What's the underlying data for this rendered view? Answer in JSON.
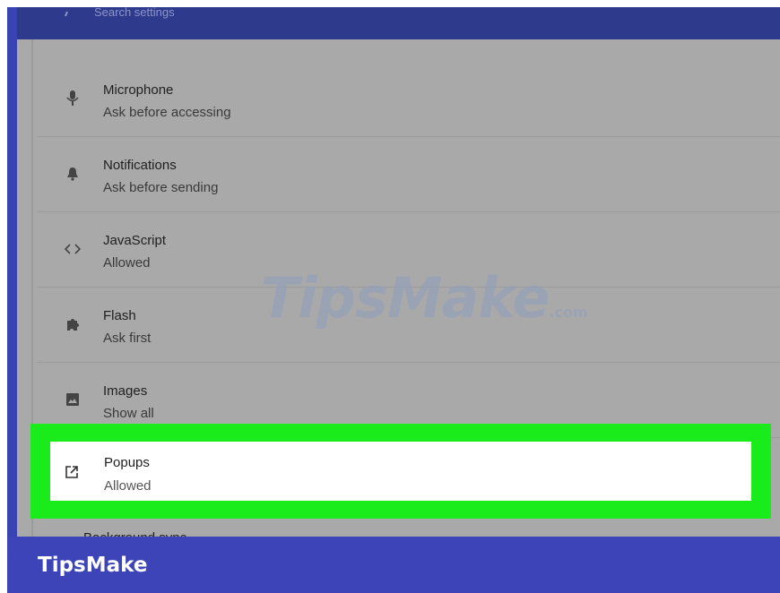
{
  "search": {
    "placeholder": "Search settings"
  },
  "settings_items": [
    {
      "title": "Microphone",
      "subtitle": "Ask before accessing",
      "icon": "microphone-icon"
    },
    {
      "title": "Notifications",
      "subtitle": "Ask before sending",
      "icon": "bell-icon"
    },
    {
      "title": "JavaScript",
      "subtitle": "Allowed",
      "icon": "code-icon"
    },
    {
      "title": "Flash",
      "subtitle": "Ask first",
      "icon": "puzzle-icon"
    },
    {
      "title": "Images",
      "subtitle": "Show all",
      "icon": "image-icon"
    }
  ],
  "highlighted_item": {
    "title": "Popups",
    "subtitle": "Allowed",
    "icon": "open-in-new-icon"
  },
  "partial_item": {
    "title": "Background sync"
  },
  "watermark": {
    "text": "TipsMake",
    "suffix": ".com"
  },
  "footer": {
    "brand": "TipsMake"
  },
  "colors": {
    "highlight": "#1aeb1a",
    "footer_bg": "#3c44b8",
    "overlay_gray": "#a9a9a9",
    "topbar_bg": "#2e3a8c"
  }
}
